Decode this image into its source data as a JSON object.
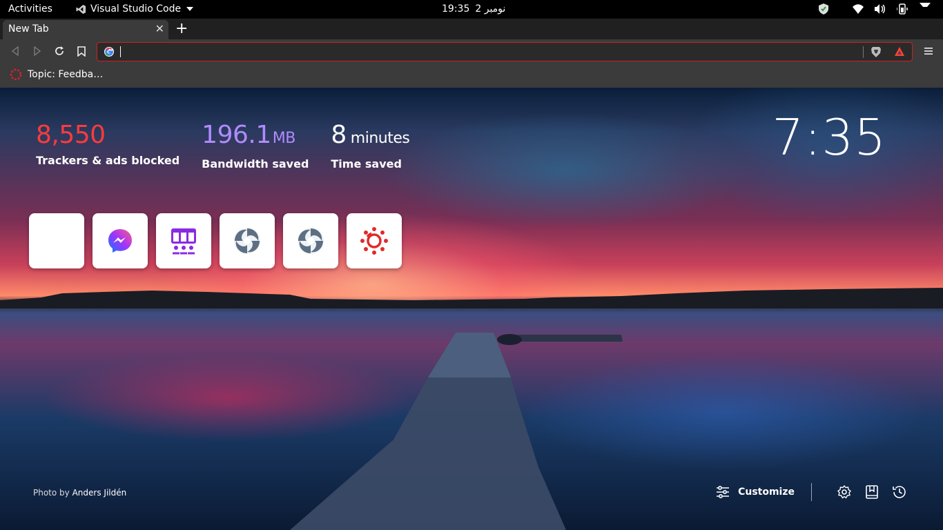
{
  "topbar": {
    "activities": "Activities",
    "app_name": "Visual Studio Code",
    "clock_time": "19:35",
    "clock_date": "نومبر 2",
    "tray_icons": [
      "shield-icon",
      "wifi-icon",
      "volume-icon",
      "battery-phone-icon",
      "power-menu-caret"
    ]
  },
  "browser": {
    "tab_title": "New Tab",
    "address_value": "",
    "address_placeholder": "",
    "bookmark_label": "Topic: Feedba…"
  },
  "ntp": {
    "stats": {
      "trackers_value": "8,550",
      "trackers_label": "Trackers & ads blocked",
      "bandwidth_value": "196.1",
      "bandwidth_unit": "MB",
      "bandwidth_label": "Bandwidth saved",
      "time_value": "8",
      "time_unit": "minutes",
      "time_label": "Time saved"
    },
    "clock": "7:35",
    "tiles": [
      "blank-tile",
      "messenger-icon",
      "sitemap-icon",
      "swirl-icon",
      "swirl-icon",
      "canvas-icon"
    ],
    "credit_prefix": "Photo by",
    "credit_author": "Anders Jildén",
    "customize_label": "Customize"
  },
  "colors": {
    "trackers": "#ff3b3b",
    "bandwidth": "#b08bff",
    "omnibox_border": "#cc2222",
    "toolbar": "#3b3b3b"
  }
}
